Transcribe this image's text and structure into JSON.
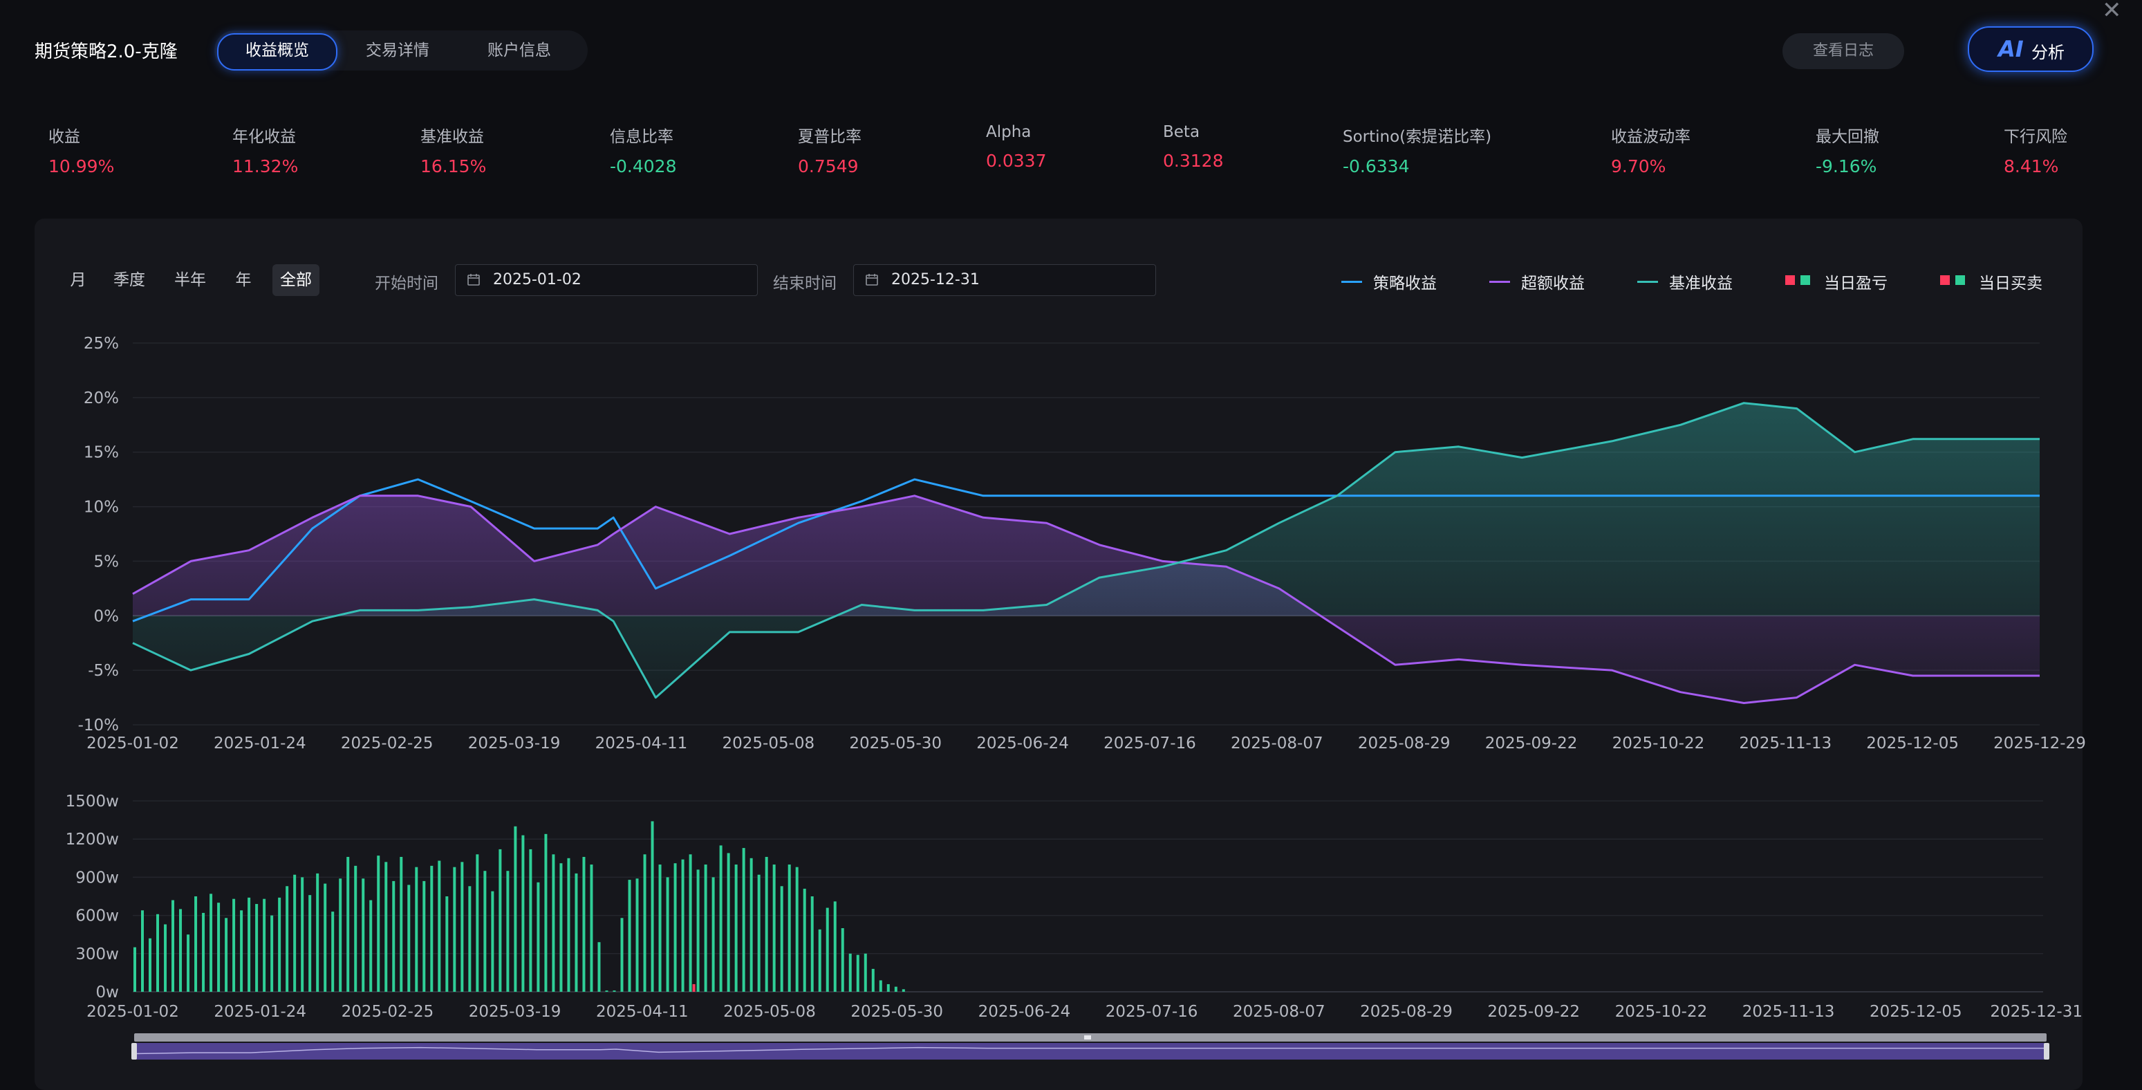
{
  "header": {
    "title": "期货策略2.0-克隆",
    "tabs": [
      {
        "label": "收益概览",
        "active": true
      },
      {
        "label": "交易详情",
        "active": false
      },
      {
        "label": "账户信息",
        "active": false
      }
    ],
    "log_button": "查看日志",
    "ai_button": {
      "glyph": "AI",
      "label": "分析"
    }
  },
  "metrics": [
    {
      "label": "收益",
      "value": "10.99%",
      "tone": "red"
    },
    {
      "label": "年化收益",
      "value": "11.32%",
      "tone": "red"
    },
    {
      "label": "基准收益",
      "value": "16.15%",
      "tone": "red"
    },
    {
      "label": "信息比率",
      "value": "-0.4028",
      "tone": "green"
    },
    {
      "label": "夏普比率",
      "value": "0.7549",
      "tone": "red"
    },
    {
      "label": "Alpha",
      "value": "0.0337",
      "tone": "red"
    },
    {
      "label": "Beta",
      "value": "0.3128",
      "tone": "red"
    },
    {
      "label": "Sortino(索提诺比率)",
      "value": "-0.6334",
      "tone": "green"
    },
    {
      "label": "收益波动率",
      "value": "9.70%",
      "tone": "red"
    },
    {
      "label": "最大回撤",
      "value": "-9.16%",
      "tone": "green"
    },
    {
      "label": "下行风险",
      "value": "8.41%",
      "tone": "red"
    }
  ],
  "controls": {
    "ranges": [
      {
        "label": "月",
        "active": false
      },
      {
        "label": "季度",
        "active": false
      },
      {
        "label": "半年",
        "active": false
      },
      {
        "label": "年",
        "active": false
      },
      {
        "label": "全部",
        "active": true
      }
    ],
    "start_label": "开始时间",
    "start_value": "2025-01-02",
    "end_label": "结束时间",
    "end_value": "2025-12-31"
  },
  "legend": [
    {
      "label": "策略收益",
      "kind": "line",
      "color": "#2aa2ff"
    },
    {
      "label": "超额收益",
      "kind": "line",
      "color": "#a55cf0"
    },
    {
      "label": "基准收益",
      "kind": "line",
      "color": "#36c0b6"
    },
    {
      "label": "当日盈亏",
      "kind": "squares",
      "colors": [
        "#ff3b5c",
        "#2fcf97"
      ]
    },
    {
      "label": "当日买卖",
      "kind": "squares",
      "colors": [
        "#ff3b5c",
        "#2fcf97"
      ]
    }
  ],
  "colors": {
    "strategy": "#2aa2ff",
    "excess": "#a55cf0",
    "benchmark": "#36c0b6",
    "volume_up": "#2fcf97",
    "volume_down": "#ff3b5c",
    "accent": "#2f6cf5"
  },
  "chart_data": [
    {
      "type": "line",
      "ylim": [
        -10,
        25
      ],
      "y_ticks": [
        "25%",
        "20%",
        "15%",
        "10%",
        "5%",
        "0%",
        "-5%",
        "-10%"
      ],
      "x_ticks": [
        "2025-01-02",
        "2025-01-24",
        "2025-02-25",
        "2025-03-19",
        "2025-04-11",
        "2025-05-08",
        "2025-05-30",
        "2025-06-24",
        "2025-07-16",
        "2025-08-07",
        "2025-08-29",
        "2025-09-22",
        "2025-10-22",
        "2025-11-13",
        "2025-12-05",
        "2025-12-29"
      ],
      "x": [
        "2025-01-02",
        "2025-01-13",
        "2025-01-24",
        "2025-02-05",
        "2025-02-14",
        "2025-02-25",
        "2025-03-07",
        "2025-03-19",
        "2025-03-31",
        "2025-04-03",
        "2025-04-11",
        "2025-04-25",
        "2025-05-08",
        "2025-05-20",
        "2025-05-30",
        "2025-06-12",
        "2025-06-24",
        "2025-07-04",
        "2025-07-16",
        "2025-07-28",
        "2025-08-07",
        "2025-08-18",
        "2025-08-29",
        "2025-09-10",
        "2025-09-22",
        "2025-10-09",
        "2025-10-22",
        "2025-11-03",
        "2025-11-13",
        "2025-11-24",
        "2025-12-05",
        "2025-12-17",
        "2025-12-29"
      ],
      "series": [
        {
          "name": "策略收益",
          "values": [
            -0.5,
            1.5,
            1.5,
            8.0,
            11.0,
            12.5,
            10.5,
            8.0,
            8.0,
            9.0,
            2.5,
            5.5,
            8.5,
            10.5,
            12.5,
            11.0,
            11.0,
            11.0,
            11.0,
            11.0,
            11.0,
            11.0,
            11.0,
            11.0,
            11.0,
            11.0,
            11.0,
            11.0,
            11.0,
            11.0,
            11.0,
            11.0,
            11.0
          ]
        },
        {
          "name": "超额收益",
          "values": [
            2.0,
            5.0,
            6.0,
            9.0,
            11.0,
            11.0,
            10.0,
            5.0,
            6.5,
            7.5,
            10.0,
            7.5,
            9.0,
            10.0,
            11.0,
            9.0,
            8.5,
            6.5,
            5.0,
            4.5,
            2.5,
            -1.0,
            -4.5,
            -4.0,
            -4.5,
            -5.0,
            -7.0,
            -8.0,
            -7.5,
            -4.5,
            -5.5,
            -5.5,
            -5.5
          ]
        },
        {
          "name": "基准收益",
          "values": [
            -2.5,
            -5.0,
            -3.5,
            -0.5,
            0.5,
            0.5,
            0.8,
            1.5,
            0.5,
            -0.5,
            -7.5,
            -1.5,
            -1.5,
            1.0,
            0.5,
            0.5,
            1.0,
            3.5,
            4.5,
            6.0,
            8.5,
            11.0,
            15.0,
            15.5,
            14.5,
            16.0,
            17.5,
            19.5,
            19.0,
            15.0,
            16.2,
            16.2,
            16.2
          ]
        }
      ]
    },
    {
      "type": "bar",
      "ylim": [
        0,
        1500
      ],
      "y_ticks": [
        "1500w",
        "1200w",
        "900w",
        "600w",
        "300w",
        "0w"
      ],
      "x_ticks": [
        "2025-01-02",
        "2025-01-24",
        "2025-02-25",
        "2025-03-19",
        "2025-04-11",
        "2025-05-08",
        "2025-05-30",
        "2025-06-24",
        "2025-07-16",
        "2025-08-07",
        "2025-08-29",
        "2025-09-22",
        "2025-10-22",
        "2025-11-13",
        "2025-12-05",
        "2025-12-31"
      ],
      "values": [
        350,
        640,
        420,
        610,
        530,
        720,
        650,
        450,
        750,
        620,
        770,
        700,
        580,
        730,
        640,
        740,
        690,
        730,
        600,
        740,
        830,
        920,
        900,
        760,
        930,
        850,
        630,
        890,
        1060,
        990,
        890,
        720,
        1070,
        1020,
        870,
        1060,
        840,
        980,
        870,
        990,
        1030,
        750,
        980,
        1020,
        830,
        1080,
        950,
        790,
        1120,
        950,
        1300,
        1230,
        1120,
        860,
        1240,
        1080,
        1010,
        1050,
        930,
        1060,
        1000,
        390,
        10,
        10,
        580,
        880,
        890,
        1080,
        1340,
        1000,
        900,
        1010,
        1040,
        1080,
        960,
        1000,
        900,
        1150,
        1090,
        1000,
        1130,
        1050,
        920,
        1060,
        1000,
        830,
        1000,
        980,
        810,
        750,
        490,
        660,
        710,
        500,
        300,
        290,
        300,
        180,
        90,
        60,
        40,
        20,
        0,
        0,
        0,
        0,
        0,
        0,
        0,
        0,
        0,
        0,
        0,
        0,
        0,
        0,
        0,
        0,
        0,
        0,
        0,
        0,
        0,
        0,
        0,
        0,
        0,
        0,
        0,
        0,
        0,
        0,
        0,
        0,
        0,
        0,
        0,
        0,
        0,
        0,
        0,
        0,
        0,
        0,
        0,
        0,
        0,
        0,
        0,
        0,
        0,
        0,
        0,
        0,
        0,
        0,
        0,
        0,
        0,
        0,
        0,
        0,
        0,
        0,
        0,
        0,
        0,
        0,
        0,
        0,
        0,
        0,
        0,
        0,
        0,
        0,
        0,
        0,
        0,
        0,
        0,
        0,
        0,
        0,
        0,
        0,
        0,
        0,
        0,
        0,
        0,
        0,
        0,
        0,
        0,
        0,
        0,
        0,
        0,
        0,
        0,
        0,
        0,
        0,
        0,
        0,
        0,
        0,
        0,
        0,
        0,
        0,
        0,
        0,
        0,
        0,
        0,
        0,
        0,
        0,
        0,
        0,
        0,
        0,
        0,
        0,
        0,
        0,
        0,
        0,
        0,
        0,
        0,
        0,
        0,
        0,
        0,
        0,
        0,
        0,
        0,
        0,
        0,
        0,
        0,
        0,
        0,
        0,
        0,
        0,
        0
      ],
      "down_index": [
        [
          74,
          60
        ]
      ]
    }
  ]
}
